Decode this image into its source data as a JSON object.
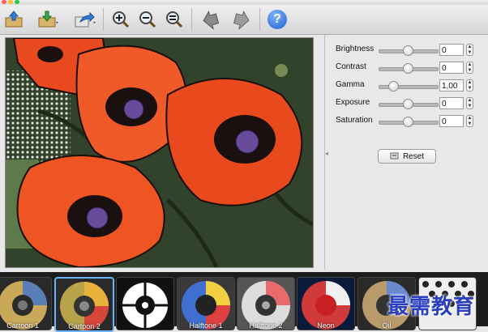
{
  "adjustments": [
    {
      "label": "Brightness",
      "value": "0",
      "level": 0.5
    },
    {
      "label": "Contrast",
      "value": "0",
      "level": 0.5
    },
    {
      "label": "Gamma",
      "value": "1,00",
      "level": 0.25
    },
    {
      "label": "Exposure",
      "value": "0",
      "level": 0.5
    },
    {
      "label": "Saturation",
      "value": "0",
      "level": 0.5
    }
  ],
  "reset_label": "Reset",
  "toolbar_icons": [
    "open-image-icon",
    "save-image-icon",
    "share-icon",
    "zoom-in-icon",
    "zoom-out-icon",
    "zoom-fit-icon",
    "undo-icon",
    "redo-icon",
    "help-icon"
  ],
  "help_glyph": "?",
  "filters": [
    {
      "label": "Cartoon 1",
      "selected": false
    },
    {
      "label": "Cartoon 2",
      "selected": true
    },
    {
      "label": "",
      "selected": false
    },
    {
      "label": "Halftone 1",
      "selected": false
    },
    {
      "label": "Halftone 2",
      "selected": false
    },
    {
      "label": "Neon",
      "selected": false
    },
    {
      "label": "Oil",
      "selected": false
    },
    {
      "label": "",
      "selected": false
    }
  ],
  "watermark": "最需教育",
  "colors": {
    "accent": "#2f7fd8",
    "selection": "#6bb3ff",
    "poppy": "#e8491f"
  }
}
